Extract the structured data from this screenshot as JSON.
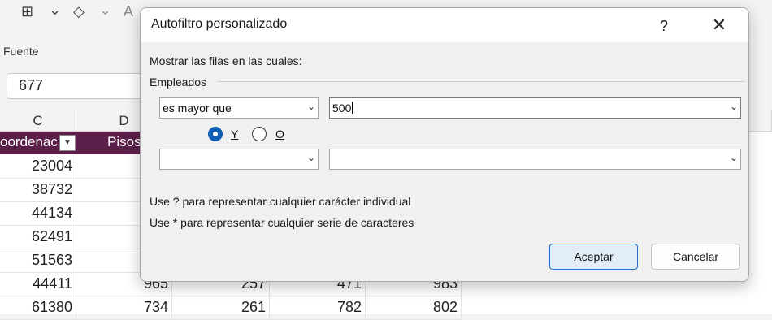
{
  "ribbon": {
    "group_label": "Fuente",
    "font_color_glyph": "A",
    "paint_glyph": "◇",
    "border_glyph": "⊞",
    "chevron": "⌄"
  },
  "name_box": {
    "value": "677"
  },
  "columns": [
    {
      "label": "C"
    },
    {
      "label": "D"
    }
  ],
  "header_cells": {
    "c": "oordenac",
    "d": "Pisos"
  },
  "rows": [
    {
      "c": "23004",
      "d": "",
      "e": "",
      "f": "",
      "g": ""
    },
    {
      "c": "38732",
      "d": "",
      "e": "",
      "f": "",
      "g": ""
    },
    {
      "c": "44134",
      "d": "",
      "e": "",
      "f": "",
      "g": ""
    },
    {
      "c": "62491",
      "d": "",
      "e": "",
      "f": "",
      "g": ""
    },
    {
      "c": "51563",
      "d": "",
      "e": "",
      "f": "",
      "g": ""
    },
    {
      "c": "44411",
      "d": "965",
      "e": "257",
      "f": "471",
      "g": "983"
    },
    {
      "c": "61380",
      "d": "734",
      "e": "261",
      "f": "782",
      "g": "802"
    }
  ],
  "dialog": {
    "title": "Autofiltro personalizado",
    "help": "?",
    "close": "✕",
    "instruction": "Mostrar las filas en las cuales:",
    "field_name": "Empleados",
    "condition1": {
      "operator": "es mayor que",
      "value": "500"
    },
    "logic": {
      "and_label": "Y",
      "or_label": "O",
      "selected": "Y"
    },
    "condition2": {
      "operator": "",
      "value": ""
    },
    "hint1": "Use ? para representar cualquier carácter individual",
    "hint2": "Use * para representar cualquier serie de caracteres",
    "ok_label": "Aceptar",
    "cancel_label": "Cancelar"
  },
  "colors": {
    "header_fill": "#5b1f4a",
    "accent": "#0f5db3"
  }
}
